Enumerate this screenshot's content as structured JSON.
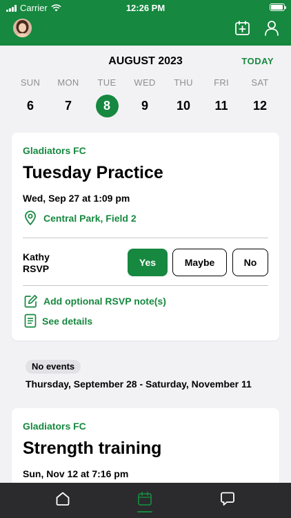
{
  "status_bar": {
    "carrier": "Carrier",
    "time": "12:26 PM"
  },
  "calendar": {
    "month_label": "AUGUST 2023",
    "today_label": "TODAY",
    "days": [
      {
        "name": "SUN",
        "num": "6"
      },
      {
        "name": "MON",
        "num": "7"
      },
      {
        "name": "TUE",
        "num": "8",
        "selected": true
      },
      {
        "name": "WED",
        "num": "9"
      },
      {
        "name": "THU",
        "num": "10"
      },
      {
        "name": "FRI",
        "num": "11"
      },
      {
        "name": "SAT",
        "num": "12"
      }
    ]
  },
  "event1": {
    "team": "Gladiators FC",
    "title": "Tuesday Practice",
    "datetime": "Wed, Sep 27 at 1:09 pm",
    "location": "Central Park, Field 2",
    "rsvp_name": "Kathy",
    "rsvp_label": "RSVP",
    "rsvp_options": [
      "Yes",
      "Maybe",
      "No"
    ],
    "rsvp_selected": "Yes",
    "add_note": "Add optional RSVP note(s)",
    "see_details": "See details"
  },
  "gap": {
    "badge": "No events",
    "range": "Thursday, September 28 - Saturday, November 11"
  },
  "event2": {
    "team": "Gladiators FC",
    "title": "Strength training",
    "datetime": "Sun, Nov 12 at 7:16 pm"
  },
  "tabs": [
    "home-icon",
    "calendar-icon",
    "chat-icon"
  ],
  "colors": {
    "accent": "#16883f",
    "tab_bar": "#2b2b2d",
    "background": "#f2f2f4"
  }
}
